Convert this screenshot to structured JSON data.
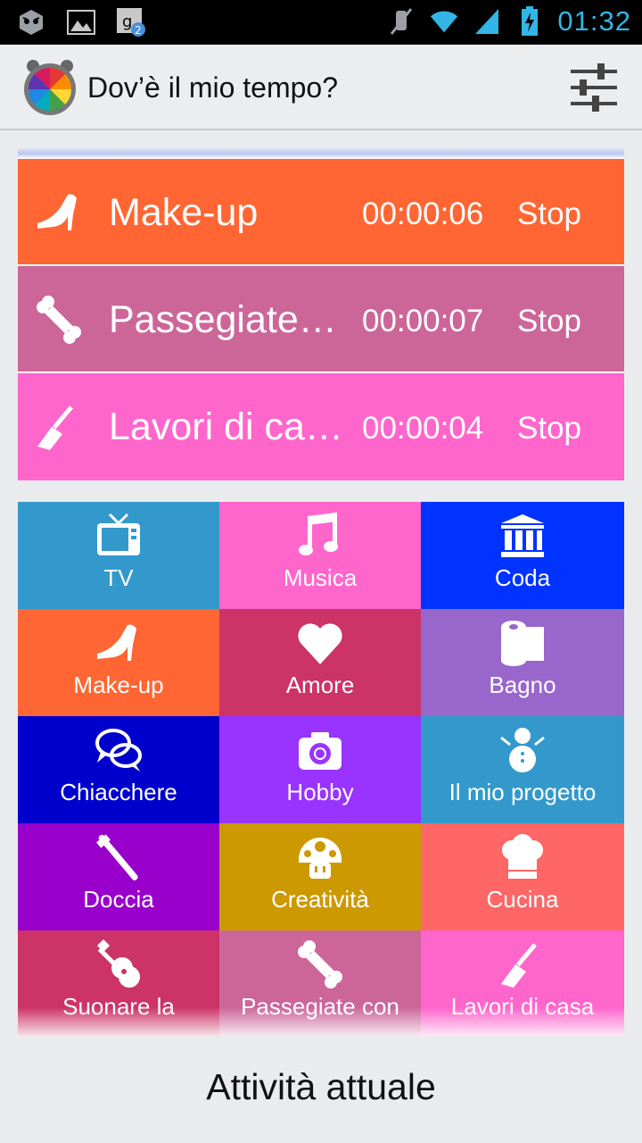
{
  "status_bar": {
    "time": "01:32",
    "left_icons": [
      "android-debug-icon",
      "image-icon",
      "translate-icon"
    ],
    "right_icons": [
      "mute-icon",
      "wifi-icon",
      "signal-icon",
      "battery-charging-icon"
    ]
  },
  "app": {
    "title": "Dov’è il mio tempo?"
  },
  "running": [
    {
      "label": "Make-up",
      "time": "00:00:06",
      "stop_label": "Stop",
      "color": "#ff6633",
      "icon": "high-heel-icon"
    },
    {
      "label": "Passegiate…",
      "time": "00:00:07",
      "stop_label": "Stop",
      "color": "#cc6699",
      "icon": "bone-icon"
    },
    {
      "label": "Lavori di ca…",
      "time": "00:00:04",
      "stop_label": "Stop",
      "color": "#ff66cc",
      "icon": "broom-icon"
    }
  ],
  "activities": [
    {
      "label": "TV",
      "color": "#3399cc",
      "icon": "tv-icon"
    },
    {
      "label": "Musica",
      "color": "#ff66cc",
      "icon": "music-note-icon"
    },
    {
      "label": "Coda",
      "color": "#0033ff",
      "icon": "bank-icon"
    },
    {
      "label": "Make-up",
      "color": "#ff6633",
      "icon": "high-heel-icon"
    },
    {
      "label": "Amore",
      "color": "#cc3366",
      "icon": "heart-icon"
    },
    {
      "label": "Bagno",
      "color": "#9966cc",
      "icon": "toilet-paper-icon"
    },
    {
      "label": "Chiacchere",
      "color": "#0000cc",
      "icon": "chat-bubbles-icon"
    },
    {
      "label": "Hobby",
      "color": "#9933ff",
      "icon": "camera-icon"
    },
    {
      "label": "Il mio progetto",
      "color": "#3399cc",
      "icon": "snowman-icon"
    },
    {
      "label": "Doccia",
      "color": "#9900cc",
      "icon": "toothbrush-icon"
    },
    {
      "label": "Creatività",
      "color": "#cc9900",
      "icon": "mushroom-icon"
    },
    {
      "label": "Cucina",
      "color": "#ff6666",
      "icon": "chef-hat-icon"
    },
    {
      "label": "Suonare la",
      "color": "#cc3366",
      "icon": "guitar-icon"
    },
    {
      "label": "Passegiate con",
      "color": "#cc6699",
      "icon": "bone-icon"
    },
    {
      "label": "Lavori di casa",
      "color": "#ff66cc",
      "icon": "broom-icon"
    }
  ],
  "footer": {
    "label": "Attività attuale"
  }
}
